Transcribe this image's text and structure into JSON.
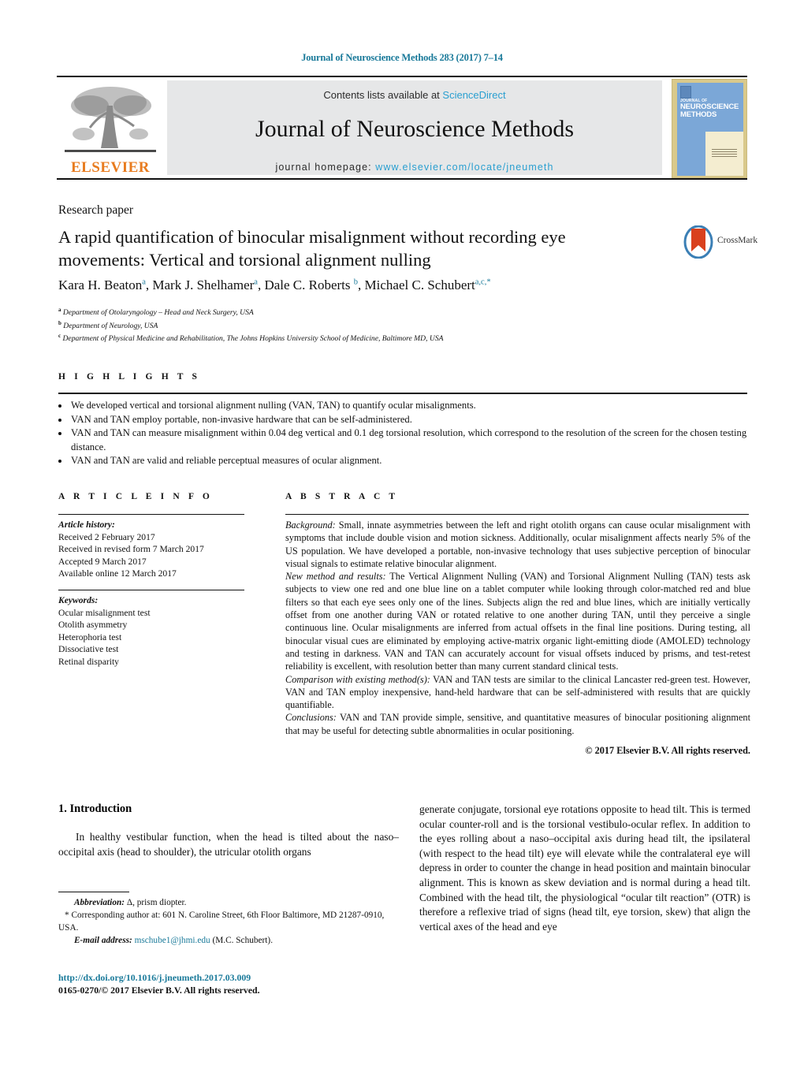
{
  "running_head": "Journal of Neuroscience Methods 283 (2017) 7–14",
  "masthead": {
    "contents_prefix": "Contents lists available at ",
    "sciencedirect": "ScienceDirect",
    "journal_name": "Journal of Neuroscience Methods",
    "homepage_prefix": "journal homepage: ",
    "homepage_url": "www.elsevier.com/locate/jneumeth",
    "publisher_logo_word": "ELSEVIER",
    "cover": {
      "line1": "JOURNAL OF",
      "line2": "NEUROSCIENCE METHODS"
    },
    "accent_blue": "#2a9fd0",
    "accent_teal": "#1a7a9a",
    "elsevier_orange": "#e87b1e",
    "grey_panel": "#e6e7e8"
  },
  "article": {
    "type": "Research paper",
    "title": "A rapid quantification of binocular misalignment without recording eye movements: Vertical and torsional alignment nulling",
    "crossmark_label": "CrossMark",
    "authors_html": "Kara H. Beaton<sup>a</sup>, Mark J. Shelhamer<sup>a</sup>, Dale C. Roberts <sup>b</sup>, Michael C. Schubert<sup>a,c,</sup><sup>*</sup>",
    "affiliations": [
      {
        "marker": "a",
        "text": "Department of Otolaryngology – Head and Neck Surgery, USA"
      },
      {
        "marker": "b",
        "text": "Department of Neurology, USA"
      },
      {
        "marker": "c",
        "text": "Department of Physical Medicine and Rehabilitation, The Johns Hopkins University School of Medicine, Baltimore MD, USA"
      }
    ]
  },
  "highlights": {
    "label": "H I G H L I G H T S",
    "items": [
      "We developed vertical and torsional alignment nulling (VAN, TAN) to quantify ocular misalignments.",
      "VAN and TAN employ portable, non-invasive hardware that can be self-administered.",
      "VAN and TAN can measure misalignment within 0.04 deg vertical and 0.1 deg torsional resolution, which correspond to the resolution of the screen for the chosen testing distance.",
      "VAN and TAN are valid and reliable perceptual measures of ocular alignment."
    ]
  },
  "article_info": {
    "label": "A R T I C L E  I N F O",
    "history_heading": "Article history:",
    "history": [
      "Received 2 February 2017",
      "Received in revised form 7 March 2017",
      "Accepted 9 March 2017",
      "Available online 12 March 2017"
    ],
    "keywords_heading": "Keywords:",
    "keywords": [
      "Ocular misalignment test",
      "Otolith asymmetry",
      "Heterophoria test",
      "Dissociative test",
      "Retinal disparity"
    ]
  },
  "abstract": {
    "label": "A B S T R A C T",
    "sections": [
      {
        "heading": "Background:",
        "text": " Small, innate asymmetries between the left and right otolith organs can cause ocular misalignment with symptoms that include double vision and motion sickness. Additionally, ocular misalignment affects nearly 5% of the US population. We have developed a portable, non-invasive technology that uses subjective perception of binocular visual signals to estimate relative binocular alignment."
      },
      {
        "heading": "New method and results:",
        "text": " The Vertical Alignment Nulling (VAN) and Torsional Alignment Nulling (TAN) tests ask subjects to view one red and one blue line on a tablet computer while looking through color-matched red and blue filters so that each eye sees only one of the lines. Subjects align the red and blue lines, which are initially vertically offset from one another during VAN or rotated relative to one another during TAN, until they perceive a single continuous line. Ocular misalignments are inferred from actual offsets in the final line positions. During testing, all binocular visual cues are eliminated by employing active-matrix organic light-emitting diode (AMOLED) technology and testing in darkness. VAN and TAN can accurately account for visual offsets induced by prisms, and test-retest reliability is excellent, with resolution better than many current standard clinical tests."
      },
      {
        "heading": "Comparison with existing method(s):",
        "text": " VAN and TAN tests are similar to the clinical Lancaster red-green test. However, VAN and TAN employ inexpensive, hand-held hardware that can be self-administered with results that are quickly quantifiable."
      },
      {
        "heading": "Conclusions:",
        "text": " VAN and TAN provide simple, sensitive, and quantitative measures of binocular positioning alignment that may be useful for detecting subtle abnormalities in ocular positioning."
      }
    ],
    "copyright": "© 2017 Elsevier B.V. All rights reserved."
  },
  "body": {
    "section_number_title": "1.  Introduction",
    "left_paragraph": "In healthy vestibular function, when the head is tilted about the naso–occipital axis (head to shoulder), the utricular otolith organs",
    "right_paragraph": "generate conjugate, torsional eye rotations opposite to head tilt. This is termed ocular counter-roll and is the torsional vestibulo-ocular reflex. In addition to the eyes rolling about a naso–occipital axis during head tilt, the ipsilateral (with respect to the head tilt) eye will elevate while the contralateral eye will depress in order to counter the change in head position and maintain binocular alignment. This is known as skew deviation and is normal during a head tilt. Combined with the head tilt, the physiological “ocular tilt reaction” (OTR) is therefore a reflexive triad of signs (head tilt, eye torsion, skew) that align the vertical axes of the head and eye"
  },
  "footnotes": {
    "abbreviation_label": "Abbreviation:",
    "abbreviation_text": " Δ, prism diopter.",
    "corresponding": "* Corresponding author at: 601 N. Caroline Street, 6th Floor Baltimore, MD 21287-0910, USA.",
    "email_label": "E-mail address:",
    "email": "mschube1@jhmi.edu",
    "email_suffix": " (M.C. Schubert).",
    "doi": "http://dx.doi.org/10.1016/j.jneumeth.2017.03.009",
    "issn_line": "0165-0270/© 2017 Elsevier B.V. All rights reserved."
  }
}
